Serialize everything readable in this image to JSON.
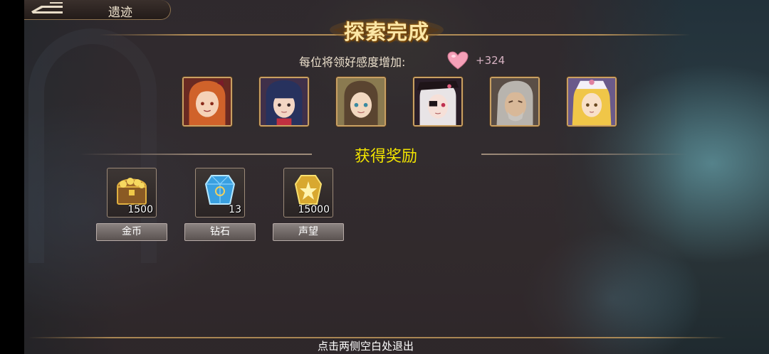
{
  "header": {
    "back_title": "遗迹"
  },
  "dialog": {
    "title": "探索完成",
    "affection_label": "每位将领好感度增加:",
    "affection_value": "+324"
  },
  "portraits": [
    {
      "name": "portrait-orange-hair-girl",
      "hair": "#d0622a",
      "skin": "#f5d2b8",
      "bg": "#6a2a22"
    },
    {
      "name": "portrait-navy-hair-girl",
      "hair": "#27325e",
      "skin": "#f3d6c4",
      "bg": "#40304a"
    },
    {
      "name": "portrait-brown-hair-girl",
      "hair": "#5a4430",
      "skin": "#f2d8c0",
      "bg": "#8a7a50"
    },
    {
      "name": "portrait-white-hair-girl",
      "hair": "#e8e4e6",
      "skin": "#f6e0d8",
      "bg": "#2a1e28"
    },
    {
      "name": "portrait-grey-hair-man",
      "hair": "#b8b4ae",
      "skin": "#d8b898",
      "bg": "#5a4e46"
    },
    {
      "name": "portrait-blonde-girl",
      "hair": "#f0c648",
      "skin": "#f8e0c8",
      "bg": "#6a5a8a"
    }
  ],
  "rewards": {
    "title": "获得奖励",
    "items": [
      {
        "name": "gold-coin",
        "label": "金币",
        "count": "1500",
        "icon": "treasure-chest-icon"
      },
      {
        "name": "diamond",
        "label": "钻石",
        "count": "13",
        "icon": "blue-crystal-icon"
      },
      {
        "name": "prestige",
        "label": "声望",
        "count": "15000",
        "icon": "gold-badge-icon"
      }
    ]
  },
  "footer": {
    "exit_hint": "点击两侧空白处退出"
  },
  "colors": {
    "gold_border": "#c8a063",
    "rewards_title": "#f2e400",
    "heart": "#f5a0b8"
  }
}
